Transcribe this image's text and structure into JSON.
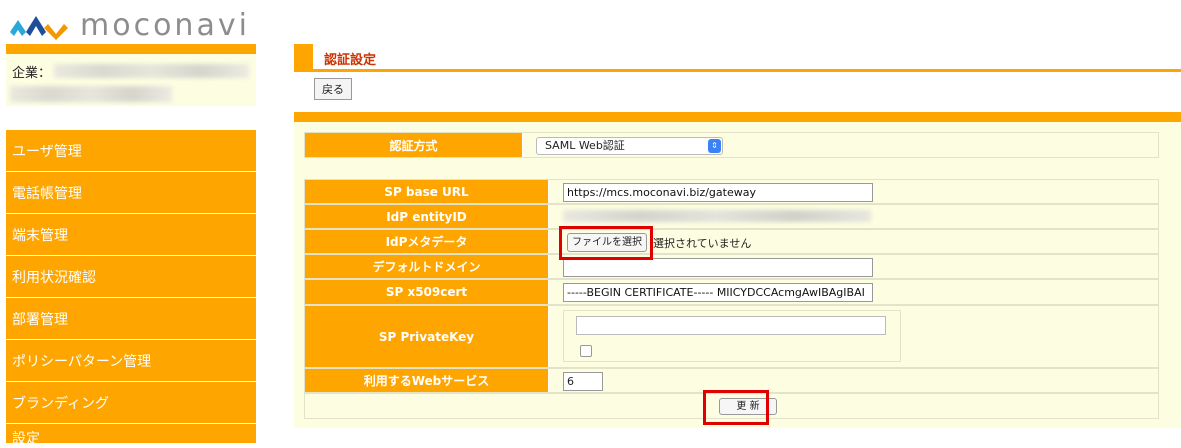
{
  "brand": {
    "name": "moconavi",
    "logo_colors": [
      "#2aa8d8",
      "#1f4e9c",
      "#f39800"
    ]
  },
  "company": {
    "label": "企業："
  },
  "sidebar": {
    "items": [
      {
        "label": "ユーザ管理"
      },
      {
        "label": "電話帳管理"
      },
      {
        "label": "端末管理"
      },
      {
        "label": "利用状況確認"
      },
      {
        "label": "部署管理"
      },
      {
        "label": "ポリシーパターン管理"
      },
      {
        "label": "ブランディング"
      },
      {
        "label": "設定"
      }
    ]
  },
  "page": {
    "title": "認証設定",
    "back_label": "戻る"
  },
  "auth": {
    "label": "認証方式",
    "selected": "SAML Web認証"
  },
  "form": {
    "sp_base_url": {
      "label": "SP base URL",
      "value": "https://mcs.moconavi.biz/gateway"
    },
    "idp_entity_id": {
      "label": "IdP entityID"
    },
    "idp_metadata": {
      "label": "IdPメタデータ",
      "button": "ファイルを選択",
      "status": "選択されていません"
    },
    "default_domain": {
      "label": "デフォルトドメイン",
      "value": ""
    },
    "sp_x509cert": {
      "label": "SP x509cert",
      "value": "-----BEGIN CERTIFICATE----- MIICYDCCAcmgAwIBAgIBAI"
    },
    "sp_private_key": {
      "label": "SP PrivateKey"
    },
    "web_service": {
      "label": "利用するWebサービス",
      "value": "6"
    }
  },
  "actions": {
    "update_label": "更 新"
  },
  "colors": {
    "accent": "#ffa500",
    "panel_bg": "#fdfde2",
    "title": "#cc3300",
    "highlight": "#e00000"
  }
}
